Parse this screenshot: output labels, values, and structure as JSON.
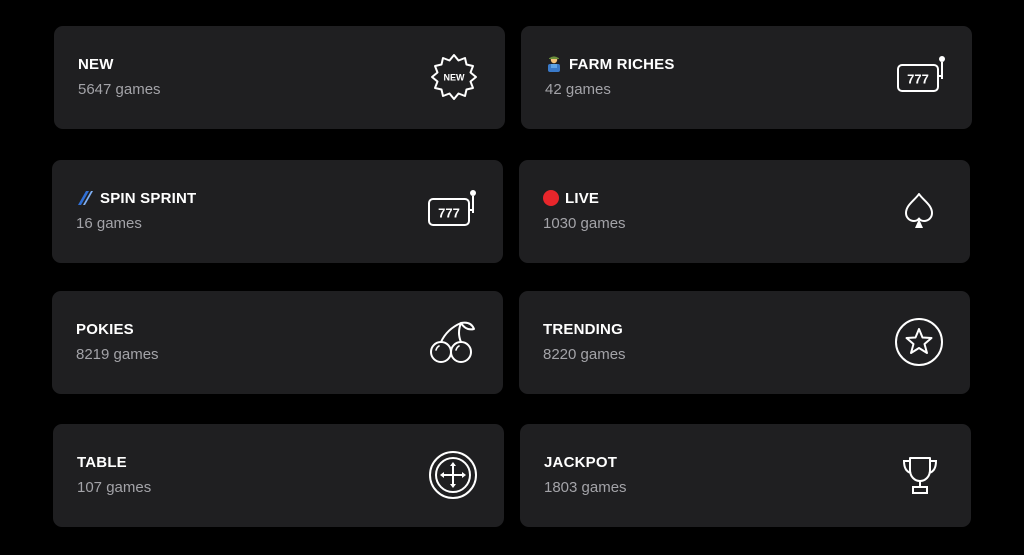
{
  "categories": [
    {
      "title": "NEW",
      "count": "5647 games",
      "icon": "new-badge-icon"
    },
    {
      "title": "FARM RICHES",
      "count": "42 games",
      "icon": "slot-machine-icon",
      "prefix_icon": "farmer-icon"
    },
    {
      "title": "SPIN SPRINT",
      "count": "16 games",
      "icon": "slot-machine-icon",
      "prefix_icon": "sprint-stripes-icon"
    },
    {
      "title": "LIVE",
      "count": "1030 games",
      "icon": "spade-icon",
      "prefix_icon": "live-dot-icon",
      "live_color": "#e8262b"
    },
    {
      "title": "POKIES",
      "count": "8219 games",
      "icon": "cherries-icon"
    },
    {
      "title": "TRENDING",
      "count": "8220 games",
      "icon": "star-circle-icon"
    },
    {
      "title": "TABLE",
      "count": "107 games",
      "icon": "roulette-chip-icon"
    },
    {
      "title": "JACKPOT",
      "count": "1803 games",
      "icon": "trophy-icon"
    }
  ],
  "badge_text": "NEW",
  "slot_text": "777",
  "colors": {
    "background": "#000000",
    "card": "#1f1f21",
    "title": "#ffffff",
    "count": "#a3a3a8"
  }
}
